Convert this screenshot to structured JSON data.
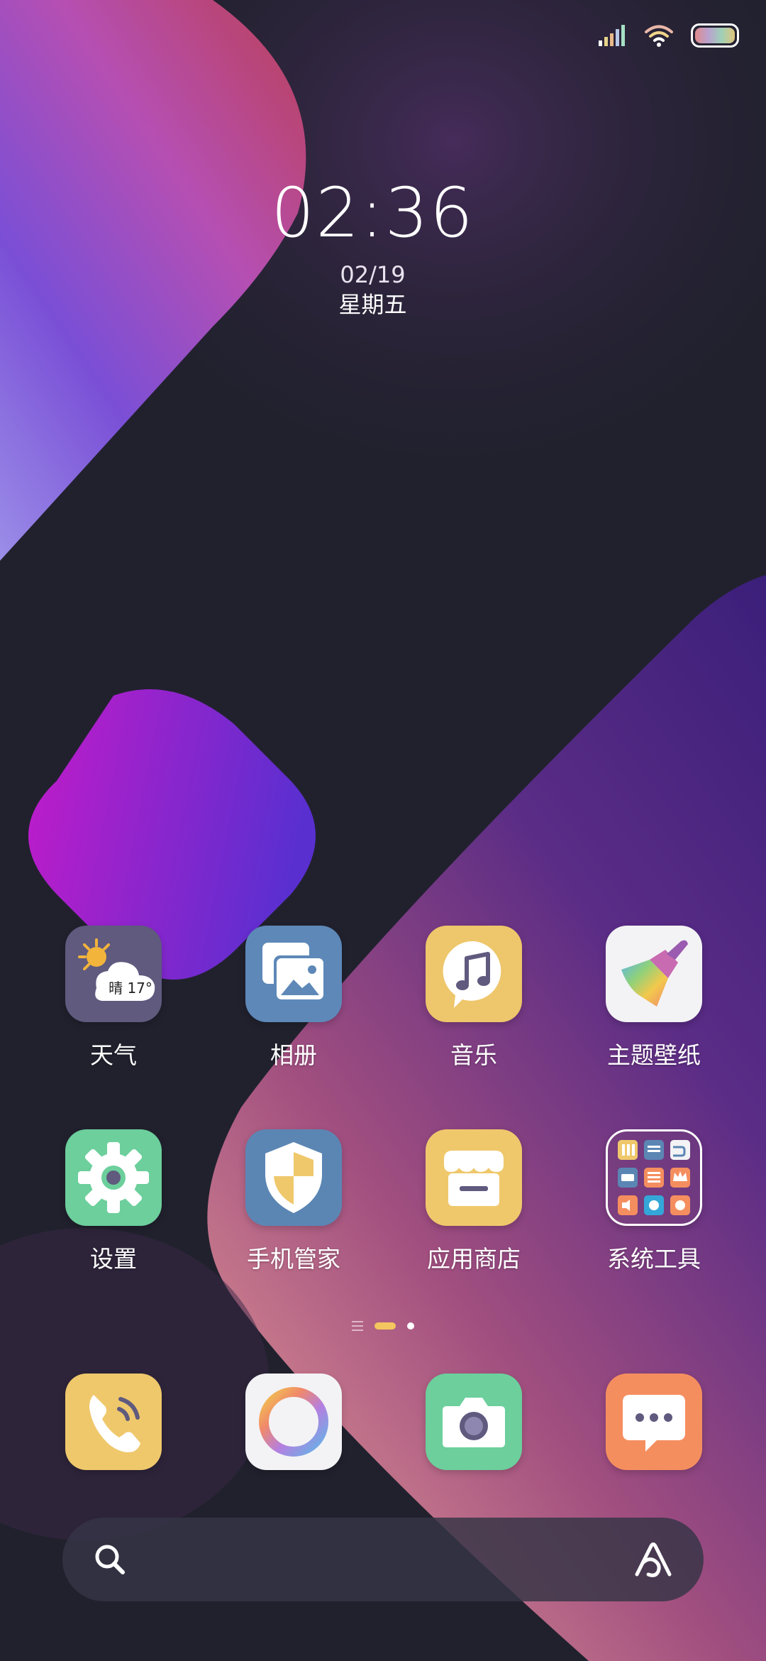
{
  "colors": {
    "background": "#22222f",
    "accent_indicator": "#f4c65f",
    "weather_icon_bg": "#5f5a7e",
    "gallery_icon_bg": "#5d88b8",
    "music_icon_bg": "#eec66b",
    "theme_icon_bg": "#f3f3f5",
    "settings_icon_bg": "#6ccf9c",
    "security_icon_bg": "#5b86b4",
    "store_icon_bg": "#efc86c",
    "phone_icon_bg": "#efc86c",
    "camera_icon_bg": "#6ccf9c",
    "messages_icon_bg": "#f58e5f"
  },
  "status_bar": {
    "icons": [
      "signal-icon",
      "wifi-icon",
      "battery-icon"
    ]
  },
  "clock": {
    "time": "02:36",
    "date": "02/19",
    "weekday": "星期五"
  },
  "weather_widget": {
    "condition_temp": "晴 17°"
  },
  "apps": {
    "weather": {
      "label": "天气",
      "icon": "weather-icon"
    },
    "gallery": {
      "label": "相册",
      "icon": "gallery-icon"
    },
    "music": {
      "label": "音乐",
      "icon": "music-icon"
    },
    "themes": {
      "label": "主题壁纸",
      "icon": "paintbrush-icon"
    },
    "settings": {
      "label": "设置",
      "icon": "gear-icon"
    },
    "security": {
      "label": "手机管家",
      "icon": "shield-icon"
    },
    "app_store": {
      "label": "应用商店",
      "icon": "store-icon"
    },
    "system_tools": {
      "label": "系统工具",
      "icon": "folder-icon"
    }
  },
  "page_indicator": {
    "pages": 3,
    "active_page": 2
  },
  "dock": {
    "items": [
      "phone-icon",
      "browser-icon",
      "camera-icon",
      "messages-icon"
    ]
  },
  "search_bar": {
    "placeholder": "",
    "icons": [
      "search-icon",
      "assistant-icon"
    ]
  }
}
